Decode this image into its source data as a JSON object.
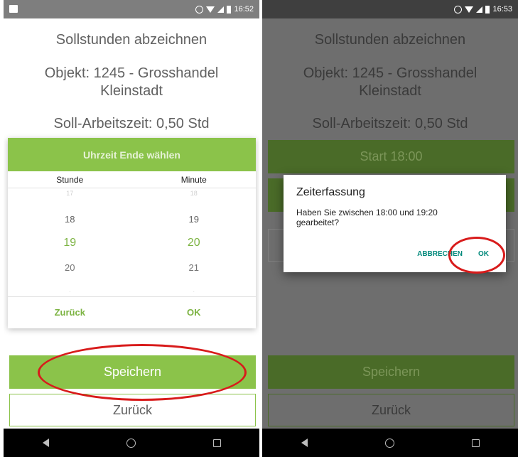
{
  "left": {
    "status_time": "16:52",
    "title": "Sollstunden abzeichnen",
    "object_line1": "Objekt: 1245 - Grosshandel",
    "object_line2": "Kleinstadt",
    "soll": "Soll-Arbeitszeit: 0,50 Std",
    "picker": {
      "header": "Uhrzeit Ende wählen",
      "col_hour": "Stunde",
      "col_minute": "Minute",
      "rows": [
        {
          "hour": "17",
          "minute": "18"
        },
        {
          "hour": "18",
          "minute": "19"
        },
        {
          "hour": "19",
          "minute": "20"
        },
        {
          "hour": "20",
          "minute": "21"
        }
      ],
      "back_label": "Zurück",
      "ok_label": "OK"
    },
    "save_label": "Speichern",
    "back_label": "Zurück"
  },
  "right": {
    "status_time": "16:53",
    "title": "Sollstunden abzeichnen",
    "object_line1": "Objekt: 1245 - Grosshandel",
    "object_line2": "Kleinstadt",
    "soll": "Soll-Arbeitszeit: 0,50 Std",
    "start_label": "Start 18:00",
    "save_label": "Speichern",
    "back_label": "Zurück",
    "dialog": {
      "title": "Zeiterfassung",
      "message": "Haben Sie zwischen 18:00 und 19:20 gearbeitet?",
      "cancel_label": "ABBRECHEN",
      "ok_label": "OK"
    }
  },
  "colors": {
    "accent_green": "#8bc34a",
    "selected_green": "#7cb342",
    "dialog_action": "#00897b",
    "annotation_red": "#d81b1b"
  }
}
